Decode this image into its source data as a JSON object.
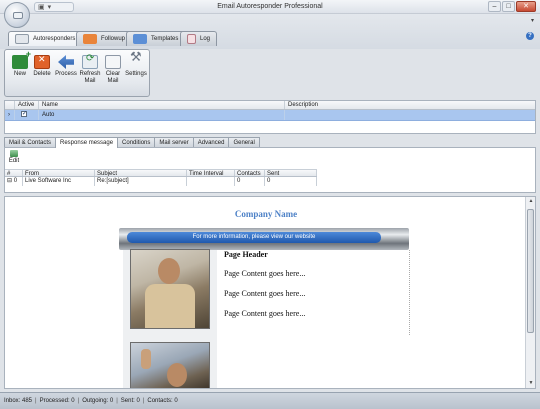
{
  "window": {
    "title": "Email Autoresponder Professional",
    "minimize": "–",
    "maximize": "□",
    "close": "✕"
  },
  "ribbon_tabs": [
    {
      "label": "Autoresponders",
      "active": true
    },
    {
      "label": "Followup"
    },
    {
      "label": "Templates"
    },
    {
      "label": "Log"
    }
  ],
  "help_label": "?",
  "toolbar": {
    "new": "New",
    "delete": "Delete",
    "process": "Process",
    "refresh_line1": "Refresh",
    "refresh_line2": "Mail",
    "clear_line1": "Clear",
    "clear_line2": "Mail",
    "settings": "Settings"
  },
  "grid1": {
    "columns": [
      "Active",
      "Name",
      "Description"
    ],
    "rows": [
      {
        "active": true,
        "name": "Auto",
        "description": ""
      }
    ]
  },
  "sub_tabs": [
    {
      "label": "Mail & Contacts"
    },
    {
      "label": "Response message",
      "active": true
    },
    {
      "label": "Conditions"
    },
    {
      "label": "Mail server"
    },
    {
      "label": "Advanced"
    },
    {
      "label": "General"
    }
  ],
  "edit_label": "Edit",
  "grid2": {
    "columns": [
      "#",
      "From",
      "Subject",
      "Time Interval",
      "Contacts",
      "Sent"
    ],
    "rows": [
      {
        "num": "0",
        "from": "Live Software Inc",
        "subject": "Re:[subject]",
        "interval": "",
        "contacts": "0",
        "sent": "0"
      }
    ]
  },
  "preview": {
    "company_name": "Company Name",
    "banner_text": "For more information, please view our website",
    "page_header": "Page Header",
    "content_lines": [
      "Page Content goes here...",
      "Page Content goes here...",
      "Page Content goes here..."
    ]
  },
  "status": {
    "inbox": "Inbox: 485",
    "processed": "Processed: 0",
    "outgoing": "Outgoing: 0",
    "sent": "Sent: 0",
    "contacts": "Contacts: 0",
    "separator": "|"
  },
  "colors": {
    "selected_row": "#a9c6ef",
    "company_name": "#4e82c7",
    "banner": "#1f59ad"
  }
}
